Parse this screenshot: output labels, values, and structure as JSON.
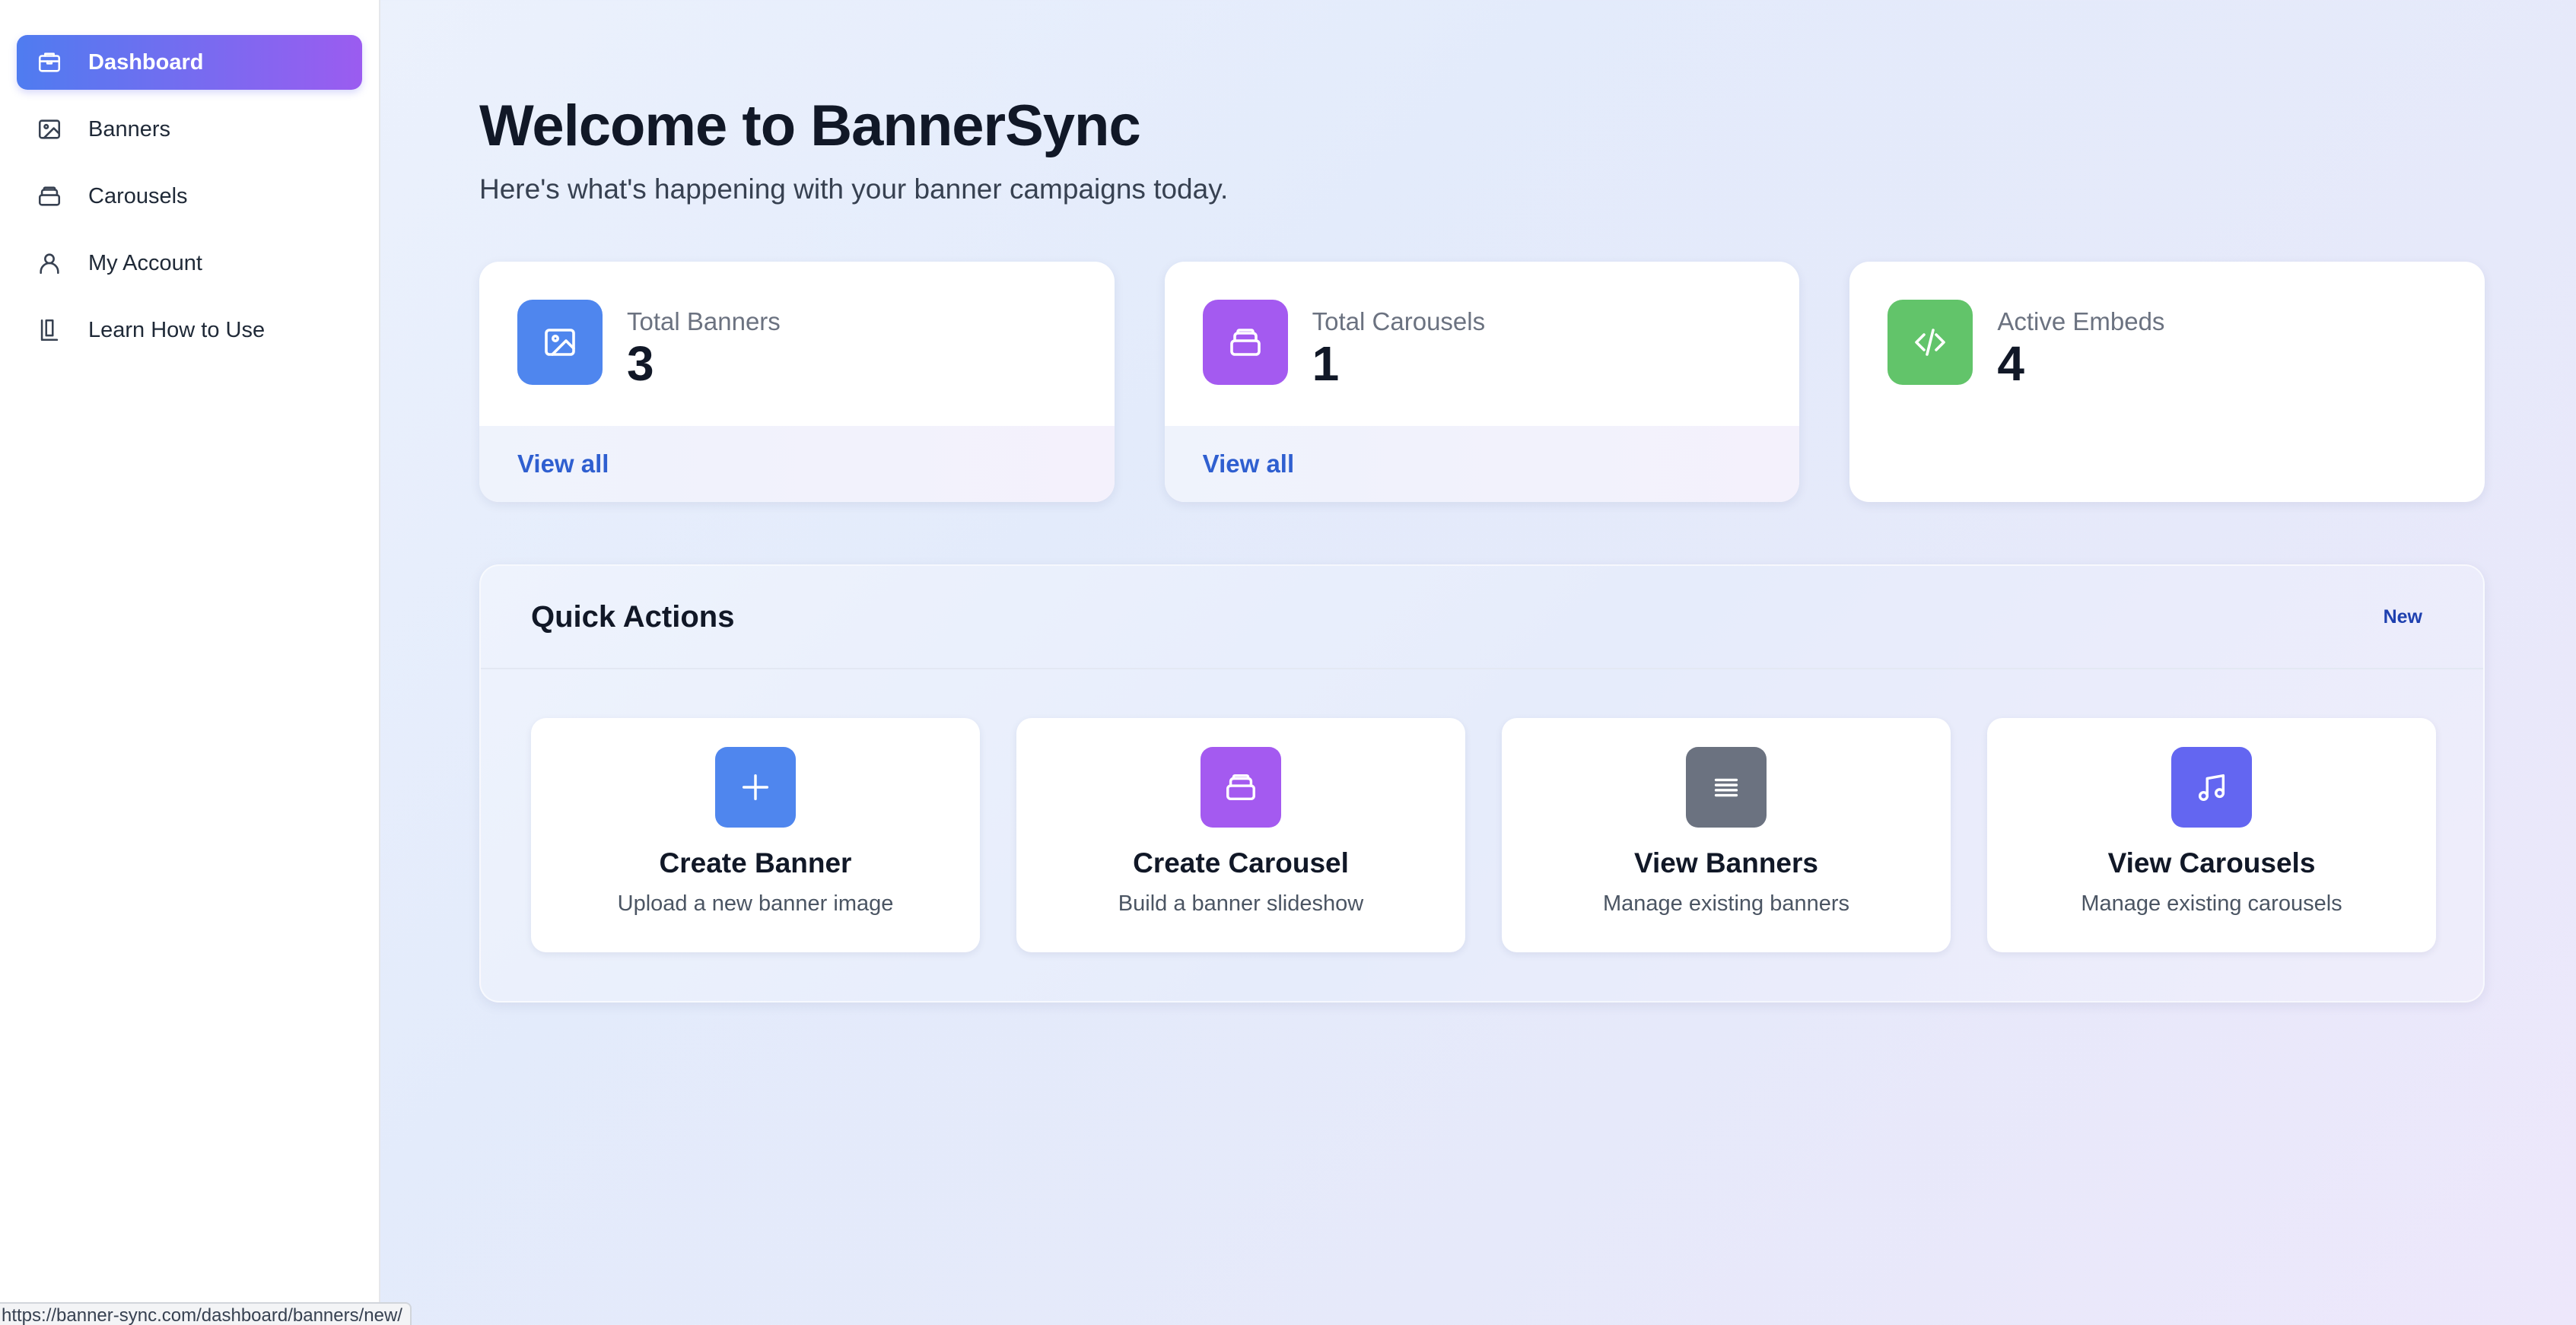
{
  "sidebar": {
    "items": [
      {
        "label": "Dashboard",
        "icon": "dashboard-icon",
        "active": true
      },
      {
        "label": "Banners",
        "icon": "image-icon"
      },
      {
        "label": "Carousels",
        "icon": "stack-icon"
      },
      {
        "label": "My Account",
        "icon": "user-icon"
      },
      {
        "label": "Learn How to Use",
        "icon": "book-icon"
      }
    ]
  },
  "header": {
    "title": "Welcome to BannerSync",
    "subtitle": "Here's what's happening with your banner campaigns today."
  },
  "stats": [
    {
      "label": "Total Banners",
      "value": "3",
      "link": "View all",
      "icon": "image-icon",
      "color": "#4f86ee"
    },
    {
      "label": "Total Carousels",
      "value": "1",
      "link": "View all",
      "icon": "stack-icon",
      "color": "#a45af0"
    },
    {
      "label": "Active Embeds",
      "value": "4",
      "icon": "code-icon",
      "color": "#62c46a"
    }
  ],
  "quick_actions": {
    "title": "Quick Actions",
    "badge": "New",
    "items": [
      {
        "title": "Create Banner",
        "desc": "Upload a new banner image",
        "icon": "plus-icon",
        "color": "#4f86ee"
      },
      {
        "title": "Create Carousel",
        "desc": "Build a banner slideshow",
        "icon": "stack-icon",
        "color": "#a45af0"
      },
      {
        "title": "View Banners",
        "desc": "Manage existing banners",
        "icon": "list-icon",
        "color": "#6b7280"
      },
      {
        "title": "View Carousels",
        "desc": "Manage existing carousels",
        "icon": "music-icon",
        "color": "#6366f1"
      }
    ]
  },
  "status_bar": {
    "url": "https://banner-sync.com/dashboard/banners/new/"
  },
  "colors": {
    "accent_start": "#4f7cf0",
    "accent_end": "#9b5cf0",
    "link": "#2f5fd0"
  }
}
